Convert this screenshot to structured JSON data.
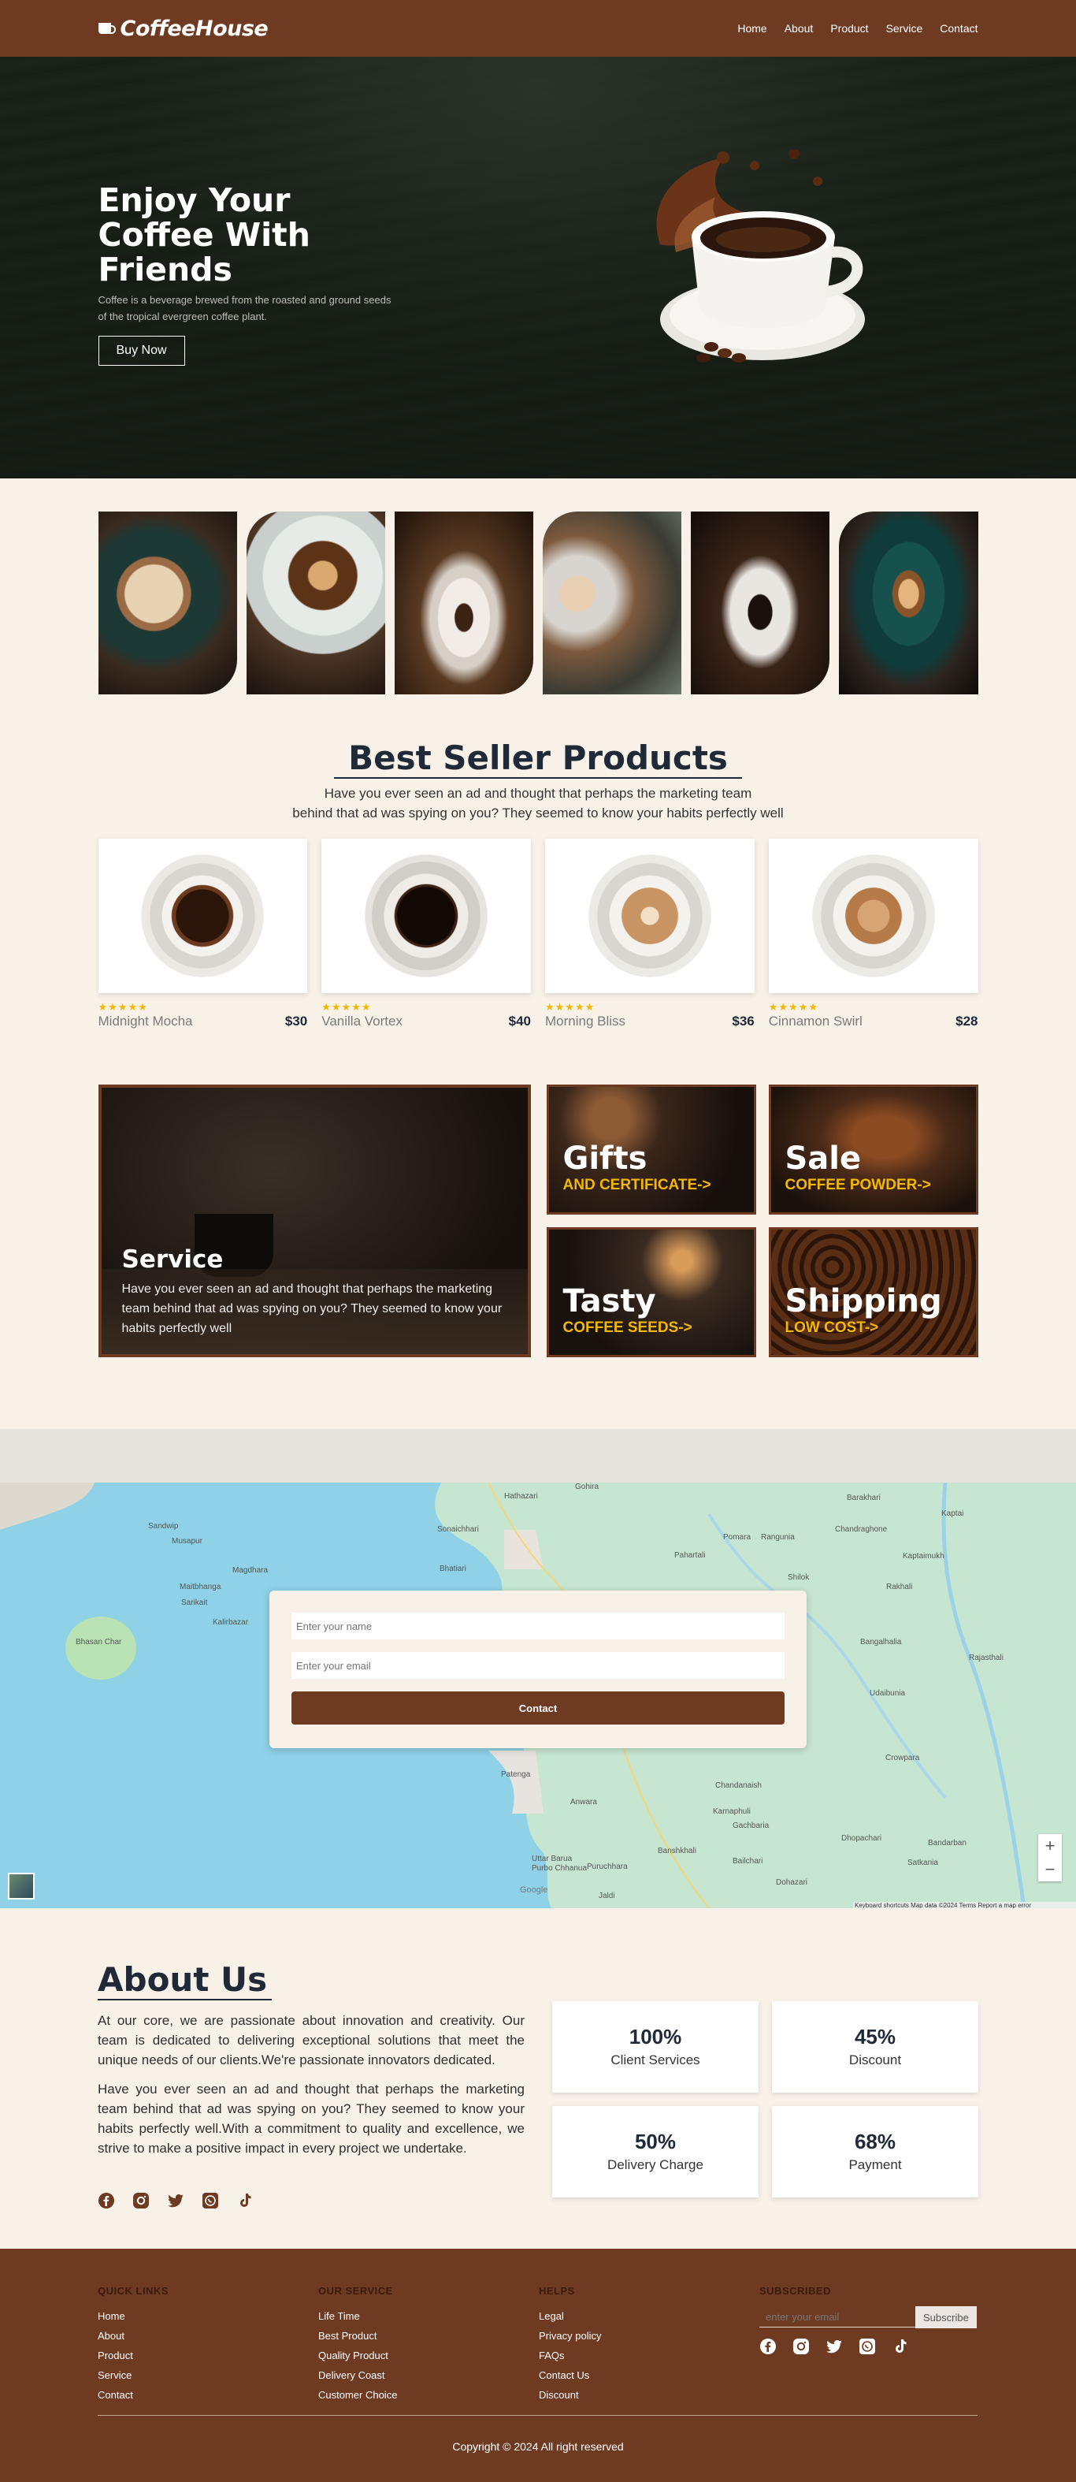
{
  "header": {
    "brand": "CoffeeHouse",
    "nav": [
      "Home",
      "About",
      "Product",
      "Service",
      "Contact"
    ]
  },
  "hero": {
    "title": "Enjoy Your Coffee With Friends",
    "subtitle": "Coffee is a beverage brewed from the roasted and ground seeds of the tropical evergreen coffee plant.",
    "button": "Buy Now"
  },
  "best_seller": {
    "title": "Best Seller Products",
    "subtitle_line1": "Have you ever seen an ad and thought that perhaps the marketing team",
    "subtitle_line2": "behind that ad was spying on you? They seemed to know your habits perfectly well",
    "products": [
      {
        "name": "Midnight Mocha",
        "price": "$30",
        "rating": 5
      },
      {
        "name": "Vanilla Vortex",
        "price": "$40",
        "rating": 5
      },
      {
        "name": "Morning Bliss",
        "price": "$36",
        "rating": 5
      },
      {
        "name": "Cinnamon Swirl",
        "price": "$28",
        "rating": 5
      }
    ]
  },
  "services": {
    "main": {
      "title": "Service",
      "text": "Have you ever seen an ad and thought that perhaps the marketing team behind that ad was spying on you? They seemed to know your habits perfectly well"
    },
    "cards": [
      {
        "title": "Gifts",
        "sub": "AND CERTIFICATE->"
      },
      {
        "title": "Sale",
        "sub": "COFFEE POWDER->"
      },
      {
        "title": "Tasty",
        "sub": "COFFEE SEEDS->"
      },
      {
        "title": "Shipping",
        "sub": "LOW COST->"
      }
    ]
  },
  "contact": {
    "name_placeholder": "Enter your name",
    "email_placeholder": "Enter your email",
    "button": "Contact",
    "map_footer": "Keyboard shortcuts   Map data ©2024   Terms   Report a map error",
    "map_labels": [
      "Hathazari",
      "Gohira",
      "Sonaichhari",
      "Pomara",
      "Rangunia",
      "Barakhari",
      "Kaptai",
      "Chandraghone",
      "Rajasthali",
      "Bangalhalia",
      "Rakhali",
      "Pahartali",
      "Bhatiari",
      "Sandwip",
      "Musapur",
      "Magdhara",
      "Maitbhanga",
      "Sarikait",
      "Bhasan Char",
      "Patenga",
      "Anwara",
      "Chandanaish",
      "Gachbaria",
      "Dhopachari",
      "Bandarban",
      "Satkania",
      "Banshkhali",
      "Bailchari",
      "Dohazari",
      "Jaldi",
      "Uttar Barua",
      "Purbo Chhanua",
      "Puruchhara",
      "Karnaphuli",
      "Kalirbazar",
      "Shilok",
      "Kaptaimukh",
      "Udaibunia",
      "Crowpara",
      "Google"
    ]
  },
  "about": {
    "title": "About Us",
    "p1": "At our core, we are passionate about innovation and creativity. Our team is dedicated to delivering exceptional solutions that meet the unique needs of our clients.We're passionate innovators dedicated.",
    "p2": "Have you ever seen an ad and thought that perhaps the marketing team behind that ad was spying on you? They seemed to know your habits perfectly well.With a commitment to quality and excellence, we strive to make a positive impact in every project we undertake.",
    "stats": [
      {
        "value": "100%",
        "label": "Client Services"
      },
      {
        "value": "45%",
        "label": "Discount"
      },
      {
        "value": "50%",
        "label": "Delivery Charge"
      },
      {
        "value": "68%",
        "label": "Payment"
      }
    ],
    "social_icons": [
      "facebook-icon",
      "instagram-icon",
      "twitter-icon",
      "whatsapp-icon",
      "tiktok-icon"
    ]
  },
  "footer": {
    "quick_links": {
      "title": "QUICK LINKS",
      "items": [
        "Home",
        "About",
        "Product",
        "Service",
        "Contact"
      ]
    },
    "our_service": {
      "title": "OUR SERVICE",
      "items": [
        "Life Time",
        "Best Product",
        "Quality Product",
        "Delivery Coast",
        "Customer Choice"
      ]
    },
    "helps": {
      "title": "HELPS",
      "items": [
        "Legal",
        "Privacy policy",
        "FAQs",
        "Contact Us",
        "Discount"
      ]
    },
    "subscribed": {
      "title": "SUBSCRIBED",
      "placeholder": "enter your email",
      "button": "Subscribe"
    },
    "copyright": "Copyright © 2024 All right reserved"
  },
  "colors": {
    "brand": "#6e3b22",
    "background": "#f7f1e8",
    "accent": "#f5b800",
    "star": "#f2b705"
  }
}
